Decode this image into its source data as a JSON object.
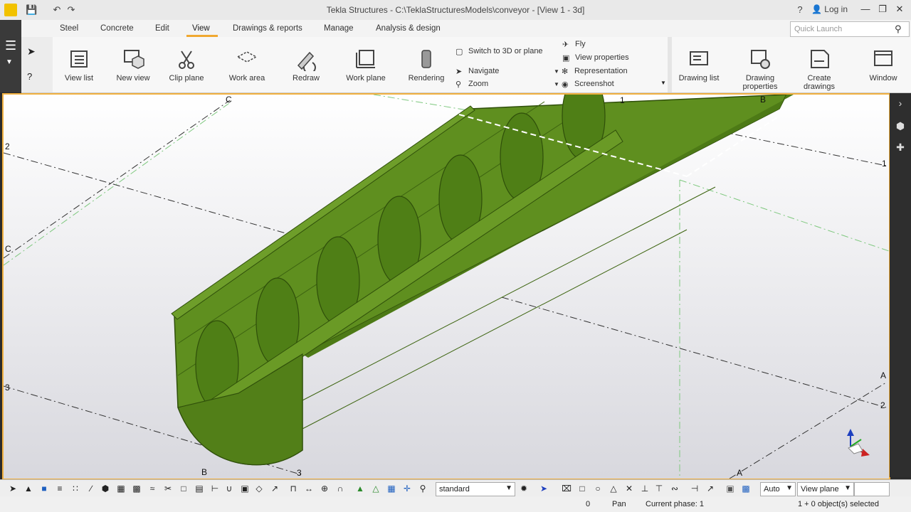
{
  "window": {
    "title": "Tekla Structures - C:\\TeklaStructuresModels\\conveyor - [View 1 - 3d]",
    "login": "Log in",
    "help": "?"
  },
  "menu": {
    "tabs": [
      "Steel",
      "Concrete",
      "Edit",
      "View",
      "Drawings & reports",
      "Manage",
      "Analysis & design"
    ],
    "active": "View"
  },
  "quick_launch": {
    "placeholder": "Quick Launch"
  },
  "ribbon": {
    "big": [
      {
        "label": "View list"
      },
      {
        "label": "New view"
      },
      {
        "label": "Clip plane"
      },
      {
        "label": "Work area"
      },
      {
        "label": "Redraw"
      },
      {
        "label": "Work plane"
      },
      {
        "label": "Rendering"
      }
    ],
    "small_col1": [
      "Switch to 3D or plane",
      "Navigate",
      "Zoom"
    ],
    "small_col2": [
      "Fly",
      "View properties",
      "Representation",
      "Screenshot"
    ],
    "drawing": [
      {
        "label": "Drawing list"
      },
      {
        "label": "Drawing properties"
      },
      {
        "label": "Create drawings"
      },
      {
        "label": "Window"
      }
    ]
  },
  "viewport": {
    "grid_labels": [
      "C",
      "B",
      "1",
      "2",
      "C",
      "3",
      "B",
      "3",
      "A",
      "A",
      "1",
      "2"
    ]
  },
  "bottom": {
    "filter": "standard",
    "auto": "Auto",
    "plane": "View plane"
  },
  "status": {
    "number": "0",
    "mode": "Pan",
    "phase": "Current phase: 1",
    "selection": "1 + 0 object(s) selected"
  },
  "colors": {
    "accent": "#f0a830",
    "model_green": "#5a8a1e"
  }
}
